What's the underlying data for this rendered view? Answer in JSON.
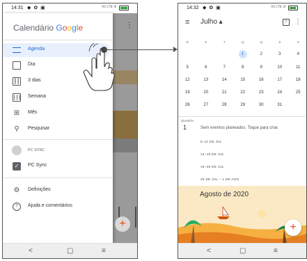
{
  "left_phone": {
    "status": {
      "time": "14:31",
      "icons": "◆ ✿ ▣",
      "network": "Vo LTE ıll"
    },
    "app_title_parts": [
      "Calendário ",
      "G",
      "o",
      "o",
      "g",
      "l",
      "e"
    ],
    "nav_items": [
      {
        "label": "Agenda",
        "icon": "agenda-icon",
        "active": true
      },
      {
        "label": "Dia",
        "icon": "day-icon",
        "active": false
      },
      {
        "label": "3 dias",
        "icon": "three-days-icon",
        "active": false
      },
      {
        "label": "Semana",
        "icon": "week-icon",
        "active": false
      },
      {
        "label": "Mês",
        "icon": "month-icon",
        "active": false
      },
      {
        "label": "Pesquisar",
        "icon": "search-icon",
        "active": false
      }
    ],
    "account": {
      "section_label": "PC SYNC",
      "calendar_label": "PC Sync"
    },
    "footer_items": [
      {
        "label": "Definições",
        "icon": "gear-icon"
      },
      {
        "label": "Ajuda e comentários",
        "icon": "help-icon"
      }
    ],
    "nav_bar": {
      "back": "<",
      "home": "▢",
      "recents": "≡"
    }
  },
  "right_phone": {
    "status": {
      "time": "14:32",
      "icons": "◆ ✿ ▣",
      "network": "Vo LTE ıll"
    },
    "header": {
      "menu": "≡",
      "month": "Julho ▴",
      "today_icon_text": "7",
      "more": "⋮"
    },
    "weekdays": [
      "D",
      "S",
      "T",
      "Q",
      "Q",
      "S",
      "S"
    ],
    "weeks": [
      [
        "",
        "",
        "",
        "1",
        "2",
        "3",
        "4"
      ],
      [
        "5",
        "6",
        "7",
        "8",
        "9",
        "10",
        "11"
      ],
      [
        "12",
        "13",
        "14",
        "15",
        "16",
        "17",
        "18"
      ],
      [
        "19",
        "20",
        "21",
        "22",
        "23",
        "24",
        "25"
      ],
      [
        "26",
        "27",
        "28",
        "29",
        "30",
        "31",
        ""
      ]
    ],
    "today_date": "1",
    "agenda": {
      "day_name": "QUARTA",
      "day_number": "1",
      "no_events": "Sem eventos planeados. Toque para criar.",
      "week_ranges": [
        "5–11 DE JUL",
        "12–18 DE JUL",
        "19–25 DE JUL",
        "26 DE JUL – 1 DE AGO"
      ]
    },
    "banner_title": "Agosto de 2020",
    "fab": "+",
    "nav_bar": {
      "back": "<",
      "home": "▢",
      "recents": "≡"
    }
  },
  "colors": {
    "accent_blue": "#1967d2",
    "active_bg": "#e8f0fe",
    "fab_red": "#ea4335",
    "banner_bg": "#fbe9c6"
  }
}
